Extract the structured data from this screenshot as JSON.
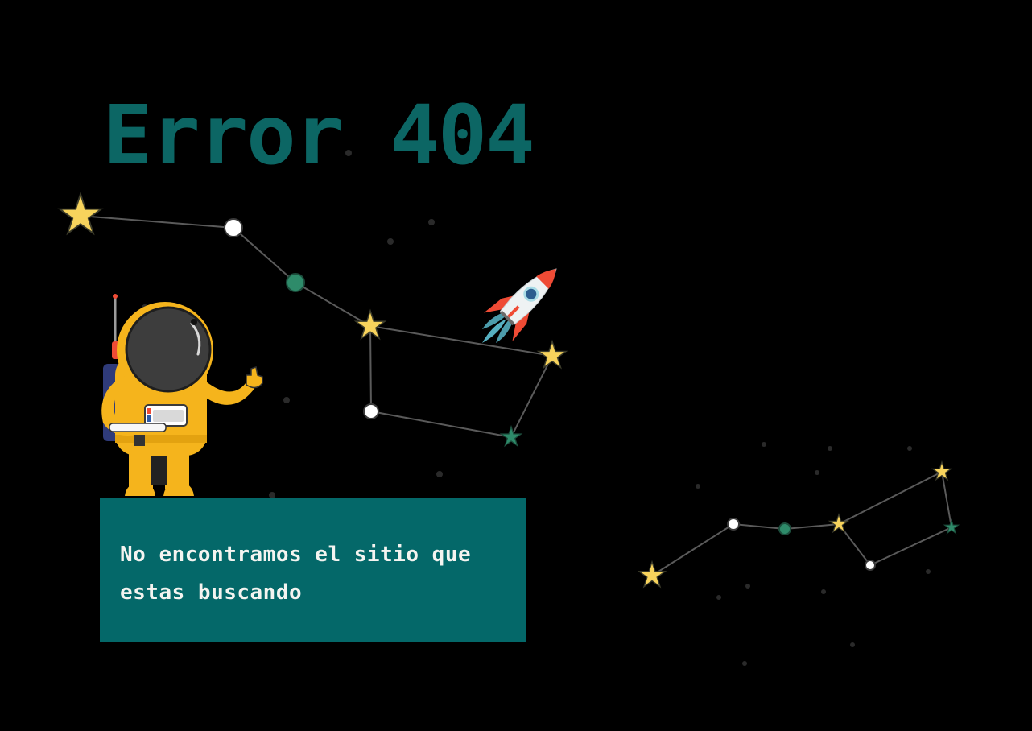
{
  "page": {
    "title": "Error 404",
    "message": "No encontramos el sitio que estas buscando"
  },
  "colors": {
    "background": "#000000",
    "title": "#0c6664",
    "message_box": "#046869",
    "message_text": "#f4f4f0",
    "star_yellow": "#f7d35c",
    "star_green": "#2e8b6a",
    "node_white": "#ffffff",
    "suit_orange": "#f5b41c",
    "rocket_red": "#ef4b35",
    "rocket_blue": "#5fc3d6"
  },
  "illustration": {
    "figures": [
      "astronaut",
      "rocket",
      "constellation-large",
      "constellation-small"
    ],
    "icons": [
      "star-icon",
      "astronaut-icon",
      "rocket-icon"
    ]
  }
}
